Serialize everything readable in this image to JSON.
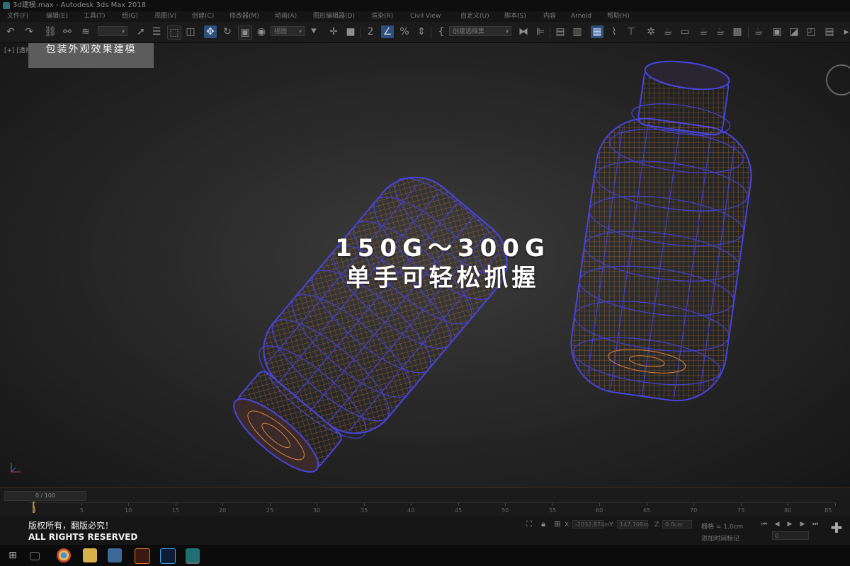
{
  "window": {
    "title": "3d建模.max - Autodesk 3ds Max 2018"
  },
  "menu": [
    "文件(F)",
    "编辑(E)",
    "工具(T)",
    "组(G)",
    "视图(V)",
    "创建(C)",
    "修改器(M)",
    "动画(A)",
    "图形编辑器(D)",
    "渲染(R)",
    "Civil View",
    "自定义(U)",
    "脚本(S)",
    "内容",
    "Arnold",
    "帮助(H)"
  ],
  "toolbar": {
    "view_dropdown": "视图",
    "selection_set_dropdown": "创建选择集"
  },
  "viewport": {
    "label": "[+] [透视]",
    "badge": "包装外观效果建模",
    "overlay_line1": "150G～300G",
    "overlay_line2": "单手可轻松抓握",
    "wire_colors": {
      "outer": "#3c3ad8",
      "inner": "#d7833a"
    }
  },
  "timeline": {
    "frame_counter": "0 / 100",
    "ticks": [
      "0",
      "5",
      "10",
      "15",
      "20",
      "25",
      "30",
      "35",
      "40",
      "45",
      "50",
      "55",
      "60",
      "65",
      "70",
      "75",
      "80",
      "85"
    ]
  },
  "status": {
    "x_label": "X:",
    "x_value": "-2032.874m",
    "y_label": "Y:",
    "y_value": "147.708m",
    "z_label": "Z:",
    "z_value": "0.0cm",
    "grid": "栅格 = 1.0cm",
    "add_time_tag": "添加时间标记",
    "frame_field": "0"
  },
  "copyright": {
    "cn": "版权所有，翻版必究！",
    "en": "ALL RIGHTS RESERVED"
  },
  "taskbar": [
    "windows-icon",
    "task-view-icon",
    "chrome-icon",
    "file-explorer-icon",
    "mail-icon",
    "illustrator-icon",
    "photoshop-icon",
    "3dsmax-icon"
  ]
}
